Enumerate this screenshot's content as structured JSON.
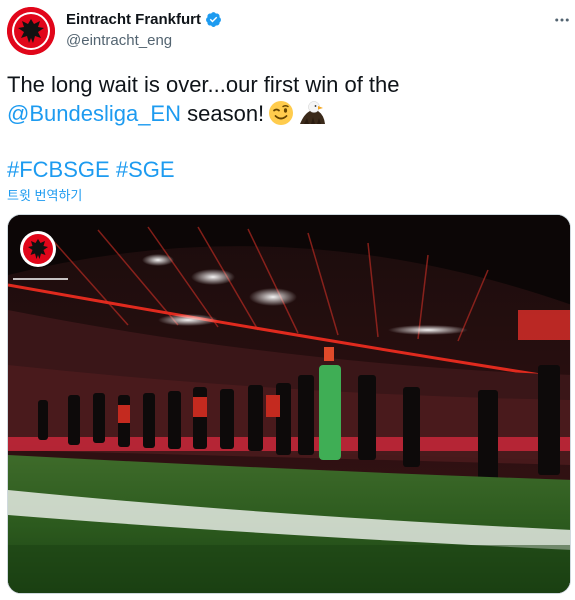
{
  "account": {
    "display_name": "Eintracht Frankfurt",
    "handle": "@eintracht_eng",
    "verified": true,
    "avatar_icon": "eagle-crest-icon",
    "brand_color": "#e1061a"
  },
  "tweet": {
    "line1": "The long wait is over...our first win of the",
    "mention": "@Bundesliga_EN",
    "line2_rest": " season!",
    "emojis": [
      "winking-face-emoji",
      "eagle-emoji"
    ],
    "hashtag1": "#FCBSGE",
    "hashtag2": "#SGE",
    "translate_label": "트윗 번역하기"
  },
  "media": {
    "description_icon": "photo-icon"
  },
  "colors": {
    "link": "#1d9bf0",
    "secondary_text": "#536471",
    "primary_text": "#0f1419"
  }
}
